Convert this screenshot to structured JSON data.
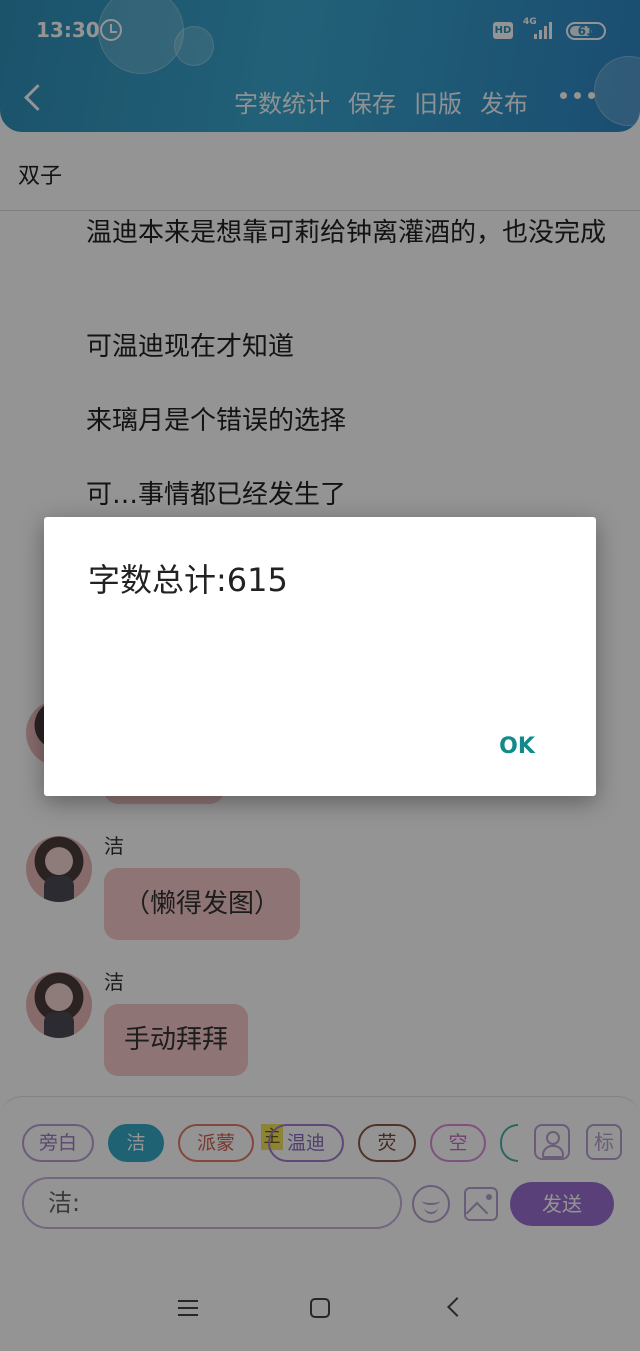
{
  "status_bar": {
    "time": "13:30",
    "hd": "HD",
    "network": "4G",
    "battery": "61"
  },
  "header": {
    "actions": [
      "字数统计",
      "保存",
      "旧版",
      "发布"
    ]
  },
  "subtitle": "双子",
  "story": {
    "paragraphs": [
      "温迪本来是想靠可莉给钟离灌酒的，也没完成",
      "可温迪现在才知道",
      "来璃月是个错误的选择",
      "可…事情都已经发生了"
    ]
  },
  "chat": {
    "messages": [
      {
        "sender": "洁",
        "text": "（懒得发图）"
      },
      {
        "sender": "洁",
        "text": "手动拜拜"
      }
    ]
  },
  "composer": {
    "chips": [
      "旁白",
      "洁",
      "派蒙",
      "温迪",
      "荧",
      "空"
    ],
    "main_tag": "主",
    "mark_label": "标",
    "input_value": "洁:",
    "send_label": "发送"
  },
  "dialog": {
    "message": "字数总计:615",
    "ok_label": "OK"
  },
  "colors": {
    "header": "#2f8fb8",
    "selected_chip": "#35a9c9",
    "bubble": "#f6c9cc",
    "send": "#9a6fd0",
    "dialog_ok": "#138a8a"
  }
}
